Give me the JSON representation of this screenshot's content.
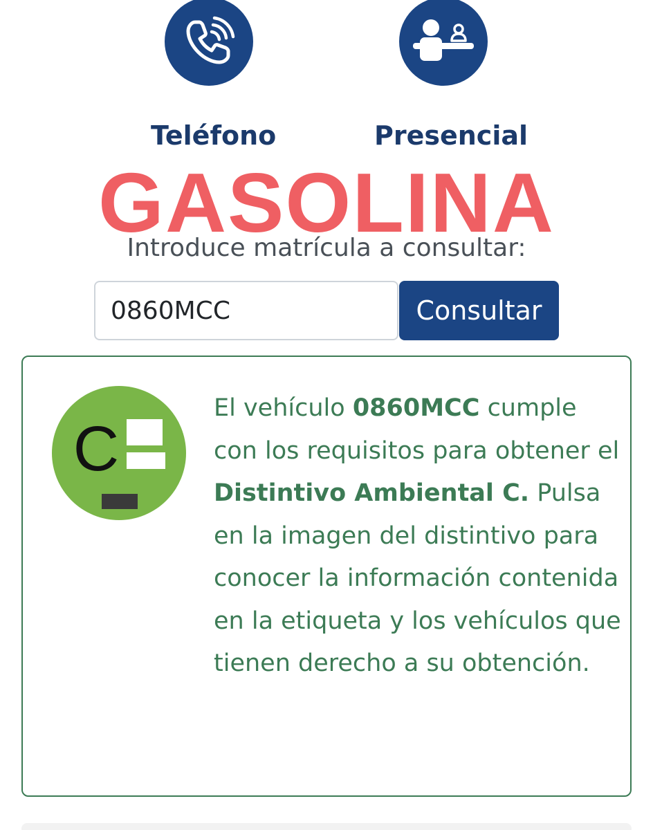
{
  "contact": {
    "phone": {
      "label": "Teléfono",
      "icon": "phone-icon"
    },
    "in_person": {
      "label": "Presencial",
      "icon": "reception-desk-icon"
    }
  },
  "overlay": {
    "text": "GASOLINA",
    "color": "#ef5f63"
  },
  "search": {
    "prompt": "Introduce matrícula a consultar:",
    "value": "0860MCC",
    "button_label": "Consultar"
  },
  "result": {
    "badge_letter": "C",
    "badge_icon": "distintivo-ambiental-c-icon",
    "text_intro": "El vehículo ",
    "plate": "0860MCC",
    "text_mid": " cumple con los requisitos para obtener el ",
    "label_name": "Distintivo Ambiental C.",
    "text_end": " Pulsa en la imagen del distintivo para conocer la información contenida en la etiqueta y los vehículos que tienen derecho a su obtención."
  },
  "colors": {
    "primary": "#1b4584",
    "success": "#3c7b55",
    "badge_green": "#7ab648"
  }
}
